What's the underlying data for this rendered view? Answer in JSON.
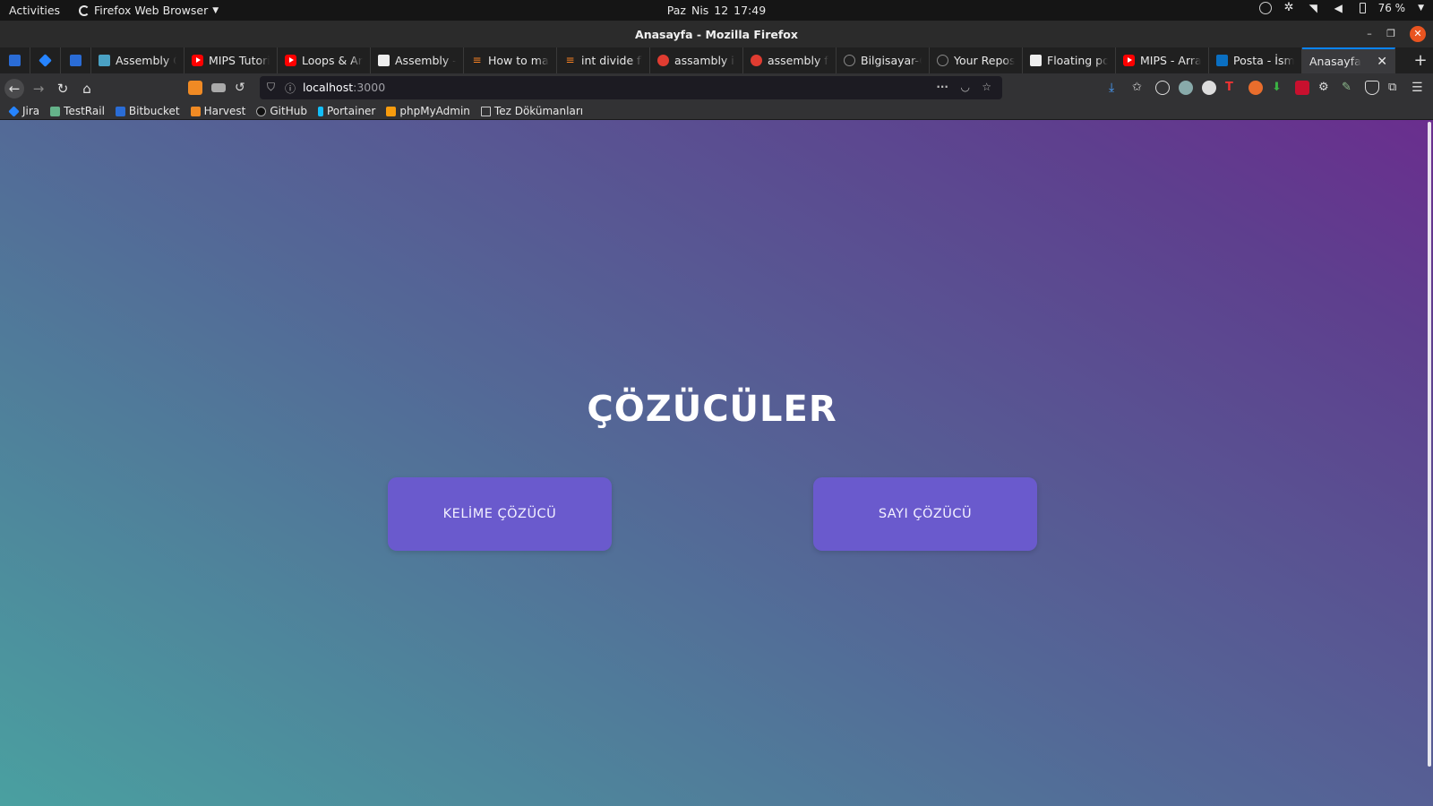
{
  "system_bar": {
    "activities": "Activities",
    "app_name": "Firefox Web Browser",
    "clock": "Paz Nis 12  17:49",
    "battery": "76 %"
  },
  "window": {
    "title": "Anasayfa - Mozilla Firefox"
  },
  "tabs": [
    {
      "label": "Assembly Ör",
      "icon": "doc-icon"
    },
    {
      "label": "MIPS Tutoria",
      "icon": "youtube-icon"
    },
    {
      "label": "Loops & Arra",
      "icon": "youtube-icon"
    },
    {
      "label": "Assembly - N",
      "icon": "doc-icon"
    },
    {
      "label": "How to make",
      "icon": "stackoverflow-icon"
    },
    {
      "label": "int divide flo",
      "icon": "stackoverflow-icon"
    },
    {
      "label": "assambly int",
      "icon": "red-circle-icon"
    },
    {
      "label": "assembly flo",
      "icon": "red-circle-icon"
    },
    {
      "label": "Bilgisayar-Or",
      "icon": "github-icon"
    },
    {
      "label": "Your Reposit",
      "icon": "github-icon"
    },
    {
      "label": "Floating poi",
      "icon": "doc-icon"
    },
    {
      "label": "MIPS - Array",
      "icon": "youtube-icon"
    },
    {
      "label": "Posta - İsme",
      "icon": "outlook-icon"
    }
  ],
  "active_tab": {
    "label": "Anasayfa",
    "close": "✕"
  },
  "navigation": {
    "url_host": "localhost",
    "url_port": ":3000"
  },
  "bookmarks": [
    {
      "label": "Jira",
      "icon": "jira-icon"
    },
    {
      "label": "TestRail",
      "icon": "testrail-icon"
    },
    {
      "label": "Bitbucket",
      "icon": "bitbucket-icon"
    },
    {
      "label": "Harvest",
      "icon": "harvest-icon"
    },
    {
      "label": "GitHub",
      "icon": "github-icon"
    },
    {
      "label": "Portainer",
      "icon": "portainer-icon"
    },
    {
      "label": "phpMyAdmin",
      "icon": "phpmyadmin-icon"
    },
    {
      "label": "Tez Dökümanları",
      "icon": "folder-icon"
    }
  ],
  "page": {
    "heading": "ÇÖZÜCÜLER",
    "word_solver_button": "KELİME ÇÖZÜCÜ",
    "number_solver_button": "SAYI ÇÖZÜCÜ"
  },
  "colors": {
    "button_bg": "#6a5acd",
    "gradient_start": "#4aa0a0",
    "gradient_end": "#6a2e8e",
    "accent": "#0a84ff"
  }
}
